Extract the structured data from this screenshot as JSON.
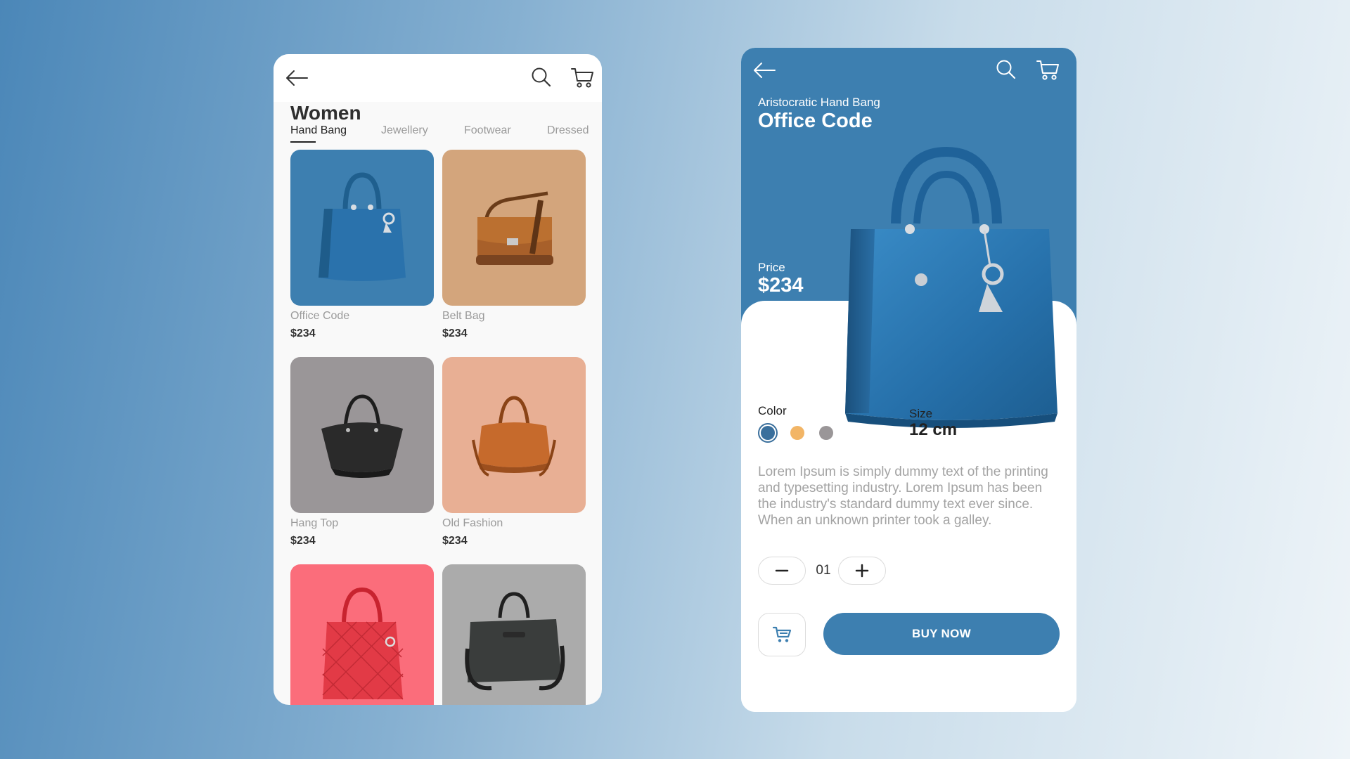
{
  "colors": {
    "accent": "#3d7fb0",
    "swatch_blue": "#3a6f9c",
    "swatch_orange": "#f2b566",
    "swatch_gray": "#9a9698"
  },
  "listing": {
    "title": "Women",
    "tabs": [
      {
        "label": "Hand Bang"
      },
      {
        "label": "Jewellery"
      },
      {
        "label": "Footwear"
      },
      {
        "label": "Dressed"
      }
    ],
    "products": [
      {
        "name": "Office Code",
        "price": "$234",
        "bg": "#3d7fb0",
        "bag": "blue-tote"
      },
      {
        "name": "Belt Bag",
        "price": "$234",
        "bg": "#d3a57c",
        "bag": "brown-messenger"
      },
      {
        "name": "Hang Top",
        "price": "$234",
        "bg": "#9a9698",
        "bag": "black-hobo"
      },
      {
        "name": "Old Fashion",
        "price": "$234",
        "bg": "#e8af94",
        "bag": "orange-duffel"
      },
      {
        "name": "",
        "price": "",
        "bg": "#fb6d7b",
        "bag": "red-quilted"
      },
      {
        "name": "",
        "price": "",
        "bg": "#ababab",
        "bag": "dark-briefcase"
      }
    ]
  },
  "detail": {
    "subtitle": "Aristocratic Hand Bang",
    "title": "Office Code",
    "price_label": "Price",
    "price": "$234",
    "color_label": "Color",
    "size_label": "Size",
    "size_value": "12 cm",
    "description": "Lorem Ipsum is simply dummy text of the printing and typesetting industry. Lorem Ipsum has been the industry's standard dummy text ever since. When an unknown printer took a galley.",
    "quantity": "01",
    "buy_label": "BUY NOW"
  }
}
